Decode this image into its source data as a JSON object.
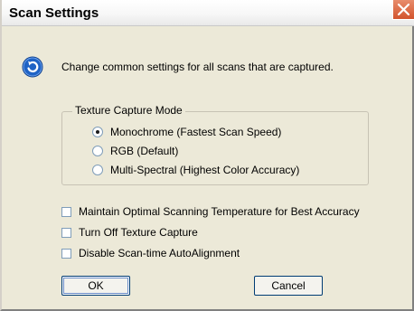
{
  "window": {
    "title": "Scan Settings",
    "close_glyph": "✕"
  },
  "intro": {
    "icon": "refresh-icon",
    "text": "Change common settings for all scans that are captured."
  },
  "texture_capture_mode": {
    "legend": "Texture Capture Mode",
    "options": [
      {
        "label": "Monochrome (Fastest Scan Speed)",
        "selected": true
      },
      {
        "label": "RGB (Default)",
        "selected": false
      },
      {
        "label": "Multi-Spectral (Highest Color Accuracy)",
        "selected": false
      }
    ]
  },
  "checkboxes": [
    {
      "label": "Maintain Optimal Scanning Temperature for Best Accuracy",
      "checked": false
    },
    {
      "label": "Turn Off Texture Capture",
      "checked": false
    },
    {
      "label": "Disable Scan-time AutoAlignment",
      "checked": false
    }
  ],
  "buttons": {
    "ok_label": "OK",
    "cancel_label": "Cancel"
  },
  "colors": {
    "close_button": "#d2532c",
    "icon_blue": "#1f63c5",
    "dialog_face": "#ece9d8"
  }
}
